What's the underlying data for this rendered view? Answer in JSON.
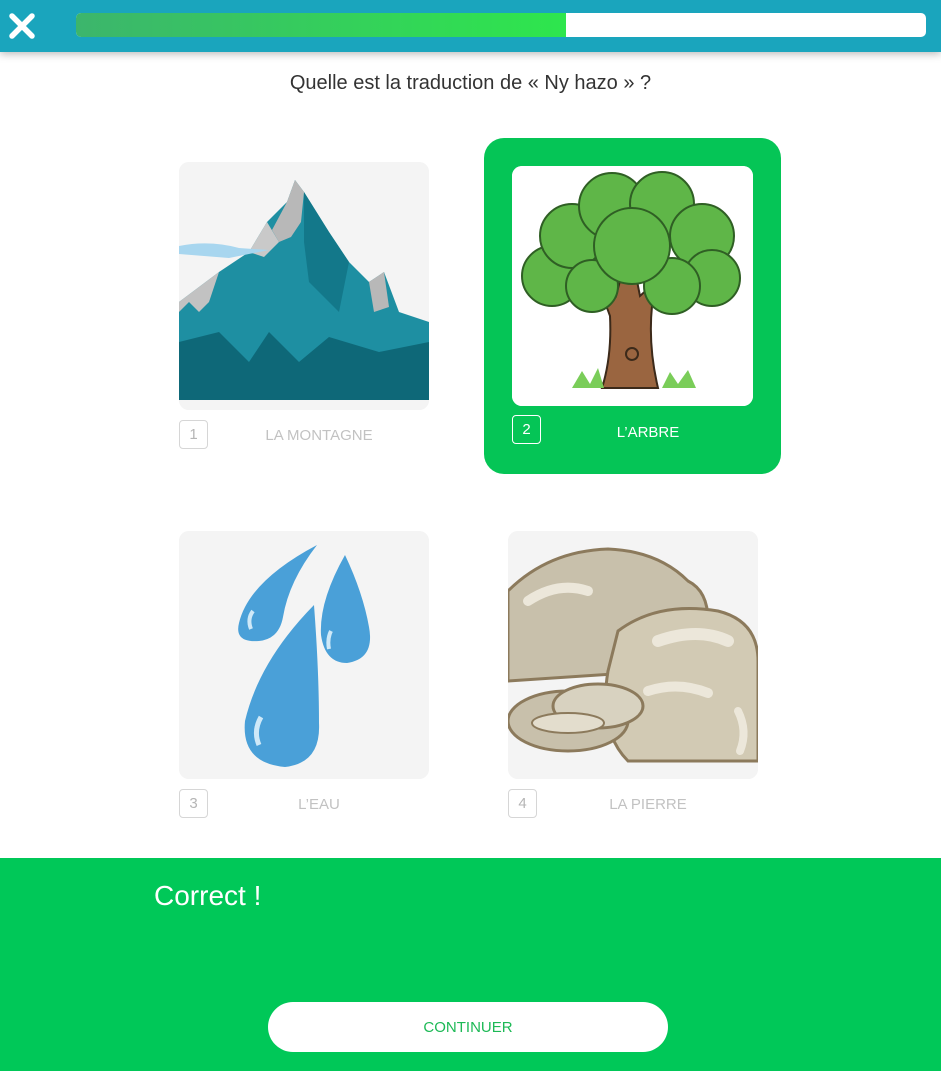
{
  "header": {
    "close_icon": "close-icon",
    "progress": 0.577,
    "progress_color": "#2ee64d",
    "bar_color": "#1aa5bd"
  },
  "question": "Quelle est la traduction de « Ny hazo » ?",
  "options": [
    {
      "number": "1",
      "label": "LA MONTAGNE",
      "image": "mountain",
      "selected": false
    },
    {
      "number": "2",
      "label": "L’ARBRE",
      "image": "tree",
      "selected": true
    },
    {
      "number": "3",
      "label": "L’EAU",
      "image": "water-drops",
      "selected": false
    },
    {
      "number": "4",
      "label": "LA PIERRE",
      "image": "stone",
      "selected": false
    }
  ],
  "feedback": {
    "title": "Correct !",
    "color": "#00c858",
    "continue_label": "CONTINUER"
  }
}
